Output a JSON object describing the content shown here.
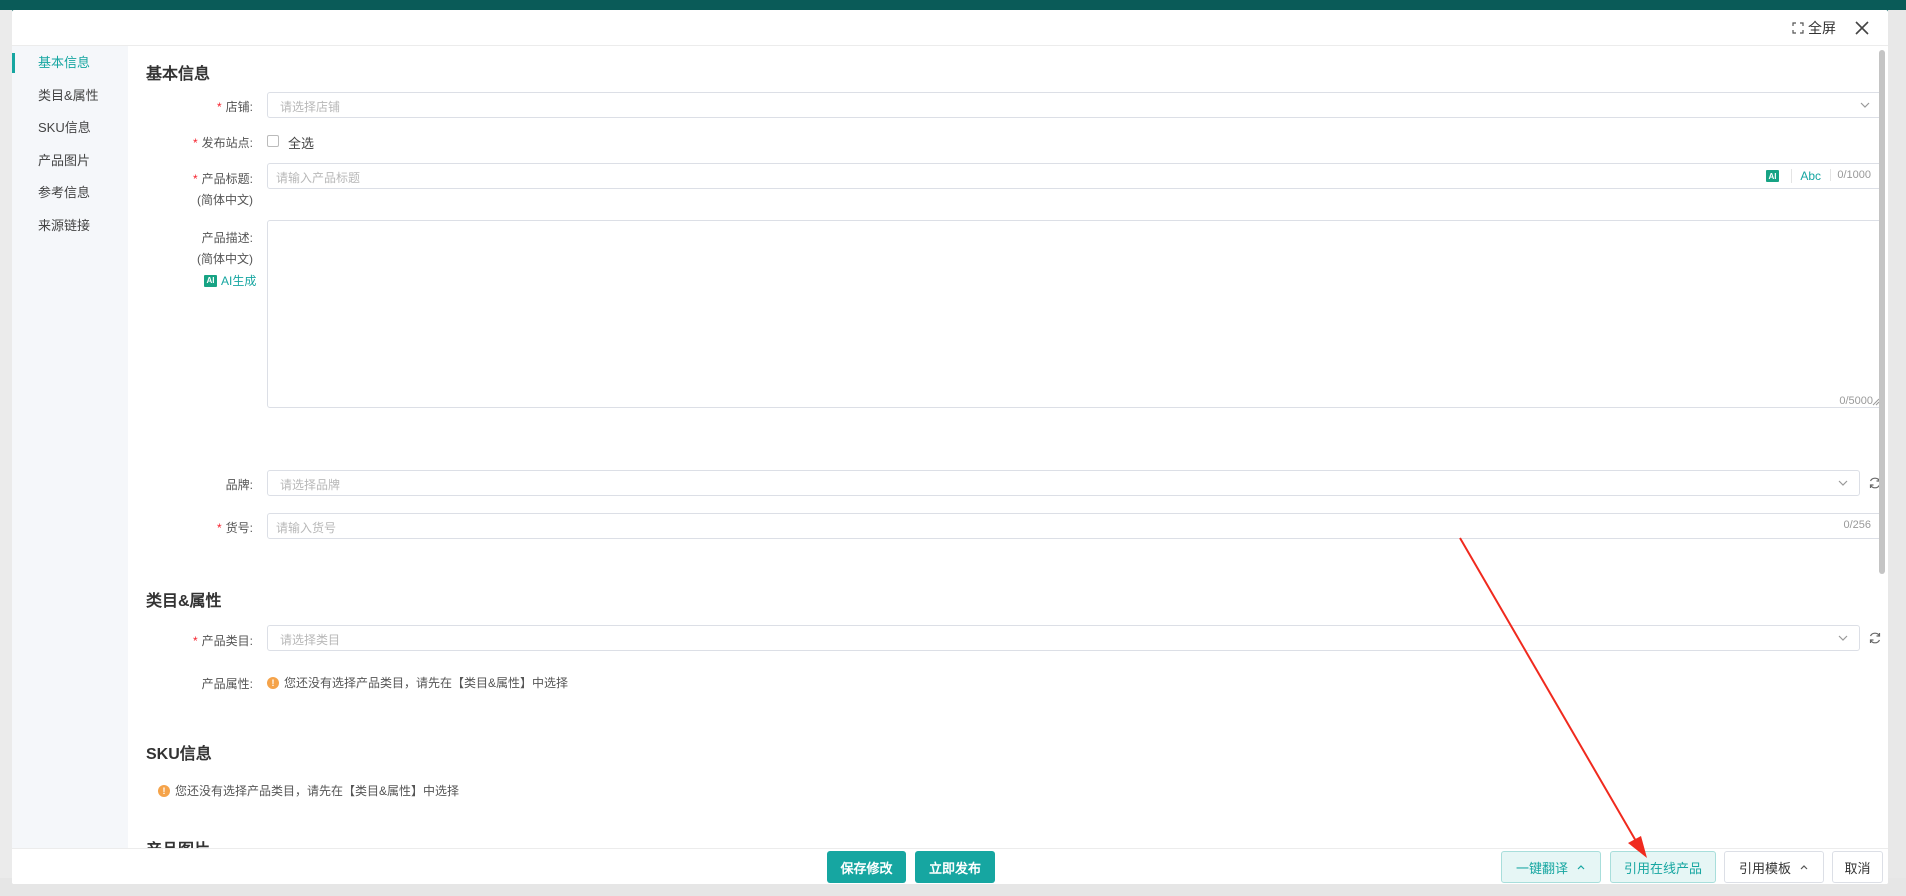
{
  "header": {
    "fullscreen_label": "全屏"
  },
  "nav": {
    "items": [
      {
        "label": "基本信息",
        "active": true
      },
      {
        "label": "类目&属性"
      },
      {
        "label": "SKU信息"
      },
      {
        "label": "产品图片"
      },
      {
        "label": "参考信息"
      },
      {
        "label": "来源链接"
      }
    ]
  },
  "basic": {
    "title": "基本信息",
    "shop": {
      "label": "店铺:",
      "placeholder": "请选择店铺"
    },
    "site": {
      "label": "发布站点:",
      "select_all": "全选"
    },
    "product_title": {
      "label": "产品标题:",
      "sublabel": "(简体中文)",
      "placeholder": "请输入产品标题",
      "ai_badge": "AI",
      "abc": "Abc",
      "counter": "0/1000"
    },
    "description": {
      "label": "产品描述:",
      "sublabel": "(简体中文)",
      "ai_badge": "AI",
      "ai_generate": "AI生成",
      "counter": "0/5000"
    },
    "brand": {
      "label": "品牌:",
      "placeholder": "请选择品牌"
    },
    "sku_no": {
      "label": "货号:",
      "placeholder": "请输入货号",
      "counter": "0/256"
    }
  },
  "category": {
    "title": "类目&属性",
    "product_category": {
      "label": "产品类目:",
      "placeholder": "请选择类目"
    },
    "product_attr": {
      "label": "产品属性:",
      "hint": "您还没有选择产品类目，请先在【类目&属性】中选择"
    }
  },
  "sku": {
    "title": "SKU信息",
    "hint": "您还没有选择产品类目，请先在【类目&属性】中选择"
  },
  "images": {
    "title": "产品图片"
  },
  "footer": {
    "save": "保存修改",
    "publish": "立即发布",
    "translate": "一键翻译",
    "quote_online": "引用在线产品",
    "quote_template": "引用模板",
    "cancel": "取消"
  },
  "colors": {
    "accent": "#16a6a1",
    "required": "#f5222d",
    "warning": "#f5a34a",
    "annotation_arrow": "#f02a1e"
  }
}
